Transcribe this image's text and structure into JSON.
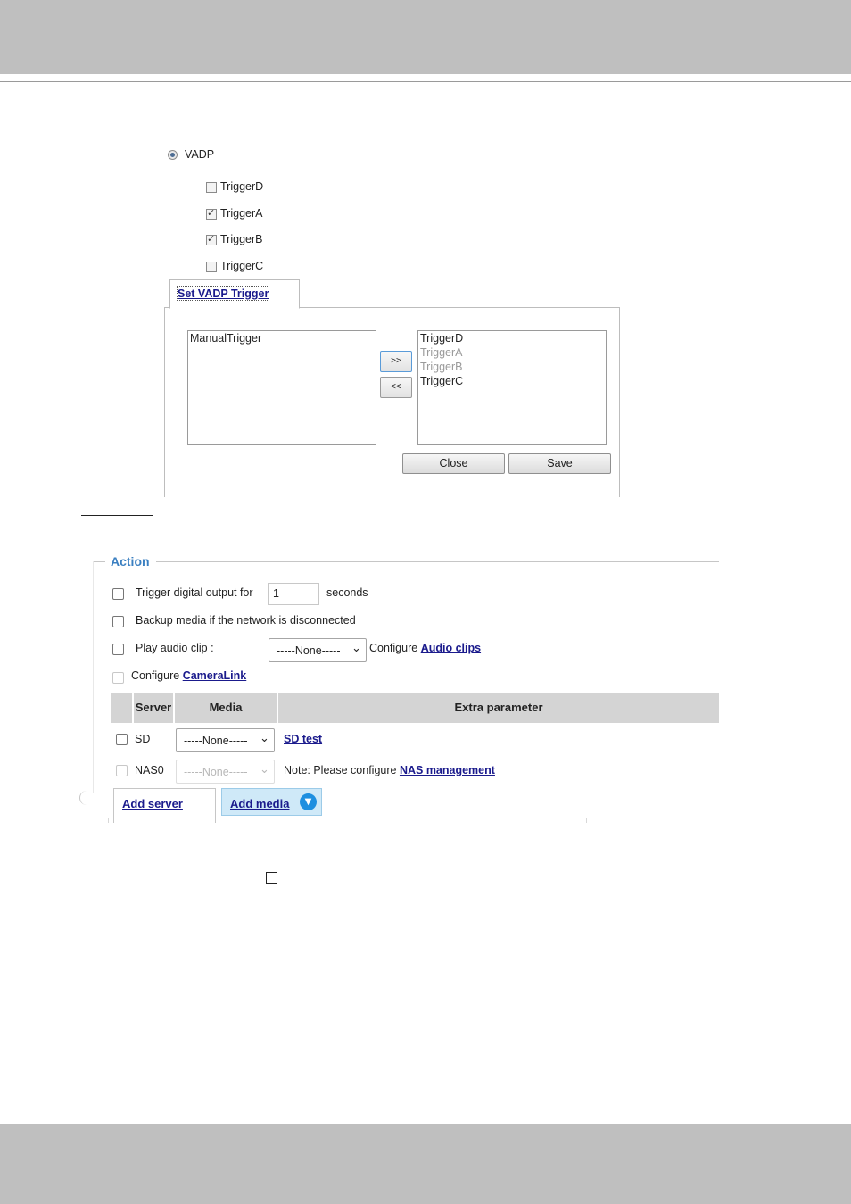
{
  "vadp": {
    "radio_label": "VADP",
    "triggers": [
      {
        "label": "TriggerD",
        "checked": false
      },
      {
        "label": "TriggerA",
        "checked": true
      },
      {
        "label": "TriggerB",
        "checked": true
      },
      {
        "label": "TriggerC",
        "checked": false
      }
    ],
    "tab_label": "Set VADP Trigger",
    "left_list": [
      "ManualTrigger"
    ],
    "right_list": [
      {
        "label": "TriggerD",
        "dim": false
      },
      {
        "label": "TriggerA",
        "dim": true
      },
      {
        "label": "TriggerB",
        "dim": true
      },
      {
        "label": "TriggerC",
        "dim": false
      }
    ],
    "add_button": ">>",
    "remove_button": "<<",
    "close_button": "Close",
    "save_button": "Save"
  },
  "action": {
    "legend": "Action",
    "trigger_output_label": "Trigger digital output for",
    "trigger_output_value": "1",
    "seconds_label": "seconds",
    "backup_label": "Backup media if the network is disconnected",
    "play_audio_label": "Play audio clip :",
    "audio_select": "-----None-----",
    "configure_label": "Configure",
    "audio_clips_link": "Audio clips",
    "cameralink_link": "CameraLink",
    "table": {
      "headers": [
        "Server",
        "Media",
        "Extra parameter"
      ],
      "rows": [
        {
          "server": "SD",
          "media": "-----None-----",
          "extra_link": "SD test",
          "extra_text": ""
        },
        {
          "server": "NAS0",
          "media": "-----None-----",
          "extra_text": "Note: Please configure",
          "extra_link": "NAS management"
        }
      ]
    },
    "add_server_tab": "Add server",
    "add_media_tab": "Add media",
    "accent_color": "#3a7fc1"
  }
}
